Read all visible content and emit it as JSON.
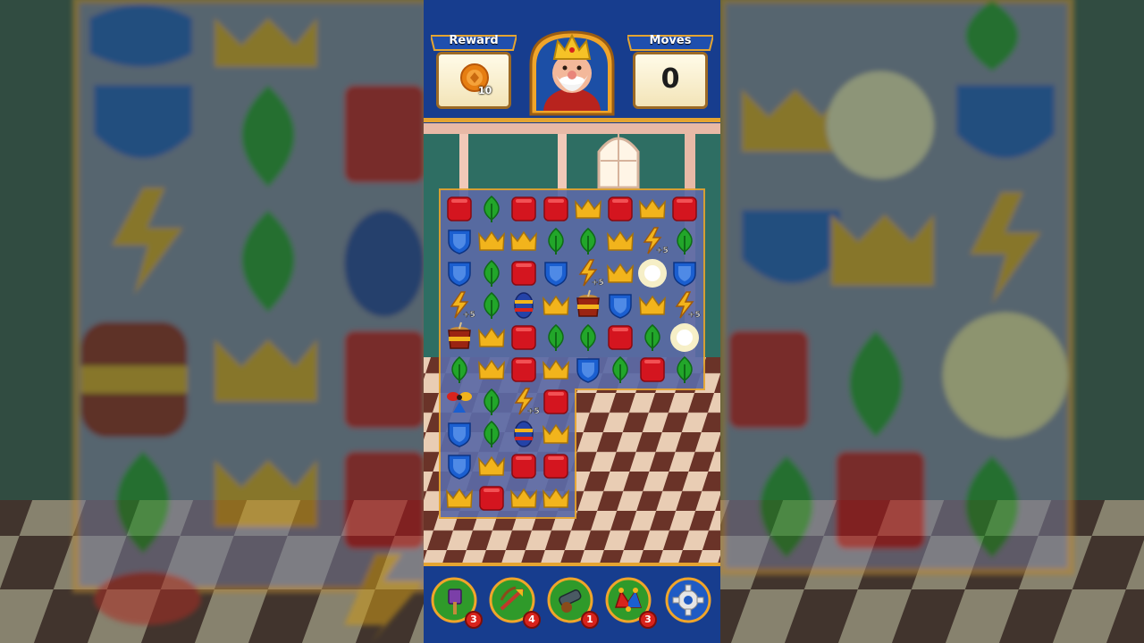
{
  "hud": {
    "reward_label": "Reward",
    "reward_count": "10",
    "moves_label": "Moves",
    "moves_value": "0"
  },
  "board": {
    "pieces": {
      "R": "red-block",
      "L": "green-leaf",
      "C": "gold-crown",
      "S": "blue-shield",
      "B": "lightning-rocket",
      "T": "tnt-barrel",
      "P": "propeller",
      "J": "striped-jewel",
      "X": "sparkle-burst"
    },
    "lightning_bonus_text": "+5",
    "rows": [
      "RLRRCRCR",
      "SCCLLCBL",
      "SLRSBCXS",
      "BLJCTSCB",
      "TCRLLRLX",
      "LCRCSLRL",
      "PLBR",
      "SLJC",
      "SCRR",
      "CRCC"
    ]
  },
  "boosters": [
    {
      "name": "hammer",
      "count": "3"
    },
    {
      "name": "arrow",
      "count": "4"
    },
    {
      "name": "cannon",
      "count": "1"
    },
    {
      "name": "jester-hat",
      "count": "3"
    }
  ],
  "colors": {
    "frame_blue": "#173d8e",
    "border_gold": "#e4a431",
    "red": "#d4151f",
    "green": "#22a62a",
    "gold": "#f2b41c",
    "blue": "#1b5fd0"
  }
}
